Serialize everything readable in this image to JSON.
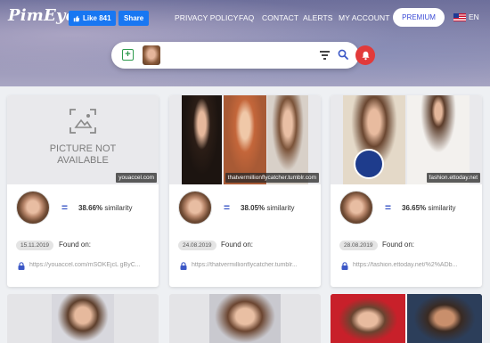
{
  "header": {
    "logo": "PimEyes",
    "fb_like": "Like 841",
    "fb_share": "Share",
    "nav": [
      "PRIVACY POLICY",
      "FAQ",
      "CONTACT",
      "ALERTS",
      "MY ACCOUNT"
    ],
    "premium": "PREMIUM",
    "lang": "EN"
  },
  "search": {
    "icons": [
      "add-photo-icon",
      "filter-icon",
      "search-icon",
      "alert-bell-icon"
    ]
  },
  "results": [
    {
      "domain": "youaccel.com",
      "na_text": "PICTURE NOT AVAILABLE",
      "similarity_value": "38.66%",
      "similarity_label": "similarity",
      "date": "15.11.2019",
      "found_label": "Found on:",
      "url": "https://youaccel.com/mSOKEjcL gByC..."
    },
    {
      "domain": "thatvermillionflycatcher.tumblr.com",
      "similarity_value": "38.05%",
      "similarity_label": "similarity",
      "date": "24.08.2019",
      "found_label": "Found on:",
      "url": "https://thatvermillionflycatcher.tumblr..."
    },
    {
      "domain": "fashion.ettoday.net",
      "similarity_value": "36.65%",
      "similarity_label": "similarity",
      "date": "28.08.2019",
      "found_label": "Found on:",
      "url": "https://fashion.ettoday.net/%2%ADb..."
    }
  ],
  "colors": {
    "accent": "#3b57c6",
    "alert": "#e23a3a",
    "facebook": "#1877f2"
  }
}
